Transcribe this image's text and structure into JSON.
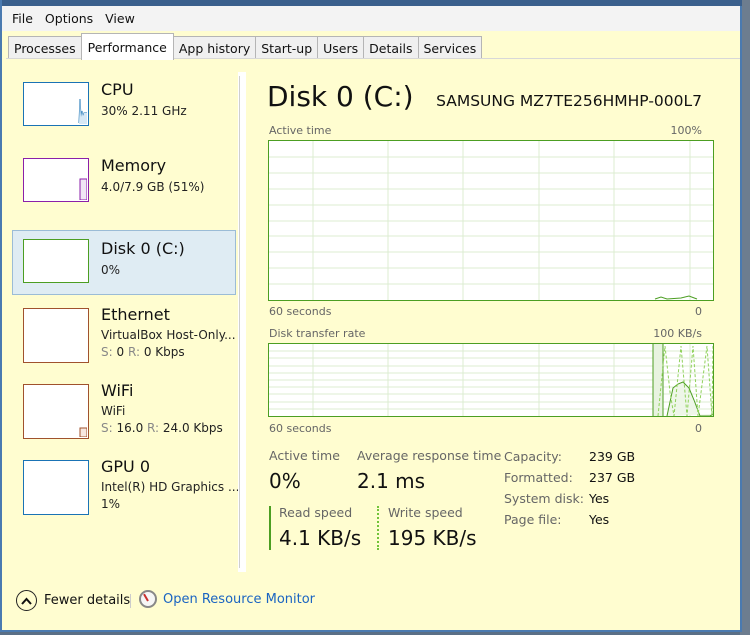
{
  "menu": [
    "File",
    "Options",
    "View"
  ],
  "tabs": [
    {
      "label": "Processes",
      "active": false
    },
    {
      "label": "Performance",
      "active": true
    },
    {
      "label": "App history",
      "active": false
    },
    {
      "label": "Start-up",
      "active": false
    },
    {
      "label": "Users",
      "active": false
    },
    {
      "label": "Details",
      "active": false
    },
    {
      "label": "Services",
      "active": false
    }
  ],
  "sidebar": {
    "items": [
      {
        "name": "CPU",
        "line1": "30%  2.11 GHz",
        "line2": "",
        "color": "#1a73b5"
      },
      {
        "name": "Memory",
        "line1": "4.0/7.9 GB (51%)",
        "line2": "",
        "color": "#8b1fa9"
      },
      {
        "name": "Disk 0 (C:)",
        "line1": "0%",
        "line2": "",
        "color": "#4c9e22",
        "selected": true
      },
      {
        "name": "Ethernet",
        "line1": "VirtualBox Host-Only...",
        "s_label": "S:",
        "s_val": "0",
        "r_label": "R:",
        "r_val": "0 Kbps",
        "color": "#a0522d"
      },
      {
        "name": "WiFi",
        "line1": "WiFi",
        "s_label": "S:",
        "s_val": "16.0",
        "r_label": "R:",
        "r_val": "24.0 Kbps",
        "color": "#a0522d"
      },
      {
        "name": "GPU 0",
        "line1": "Intel(R) HD Graphics ...",
        "line2": "1%",
        "color": "#1a73b5"
      }
    ]
  },
  "main": {
    "title": "Disk 0 (C:)",
    "model": "SAMSUNG MZ7TE256HMHP-000L7",
    "graph1": {
      "label": "Active time",
      "max": "100%",
      "left": "60 seconds",
      "right": "0"
    },
    "graph2": {
      "label": "Disk transfer rate",
      "max": "100 KB/s",
      "left": "60 seconds",
      "right": "0"
    },
    "stats": {
      "active_time_label": "Active time",
      "active_time": "0%",
      "avg_resp_label": "Average response time",
      "avg_resp": "2.1 ms",
      "read_label": "Read speed",
      "read": "4.1 KB/s",
      "write_label": "Write speed",
      "write": "195 KB/s"
    },
    "info": [
      {
        "k": "Capacity:",
        "v": "239 GB"
      },
      {
        "k": "Formatted:",
        "v": "237 GB"
      },
      {
        "k": "System disk:",
        "v": "Yes"
      },
      {
        "k": "Page file:",
        "v": "Yes"
      }
    ]
  },
  "footer": {
    "fewer_details": "Fewer details",
    "resource_monitor": "Open Resource Monitor"
  },
  "colors": {
    "disk": "#4c9e22",
    "link": "#1a64c2",
    "bg": "#fffdd0"
  }
}
